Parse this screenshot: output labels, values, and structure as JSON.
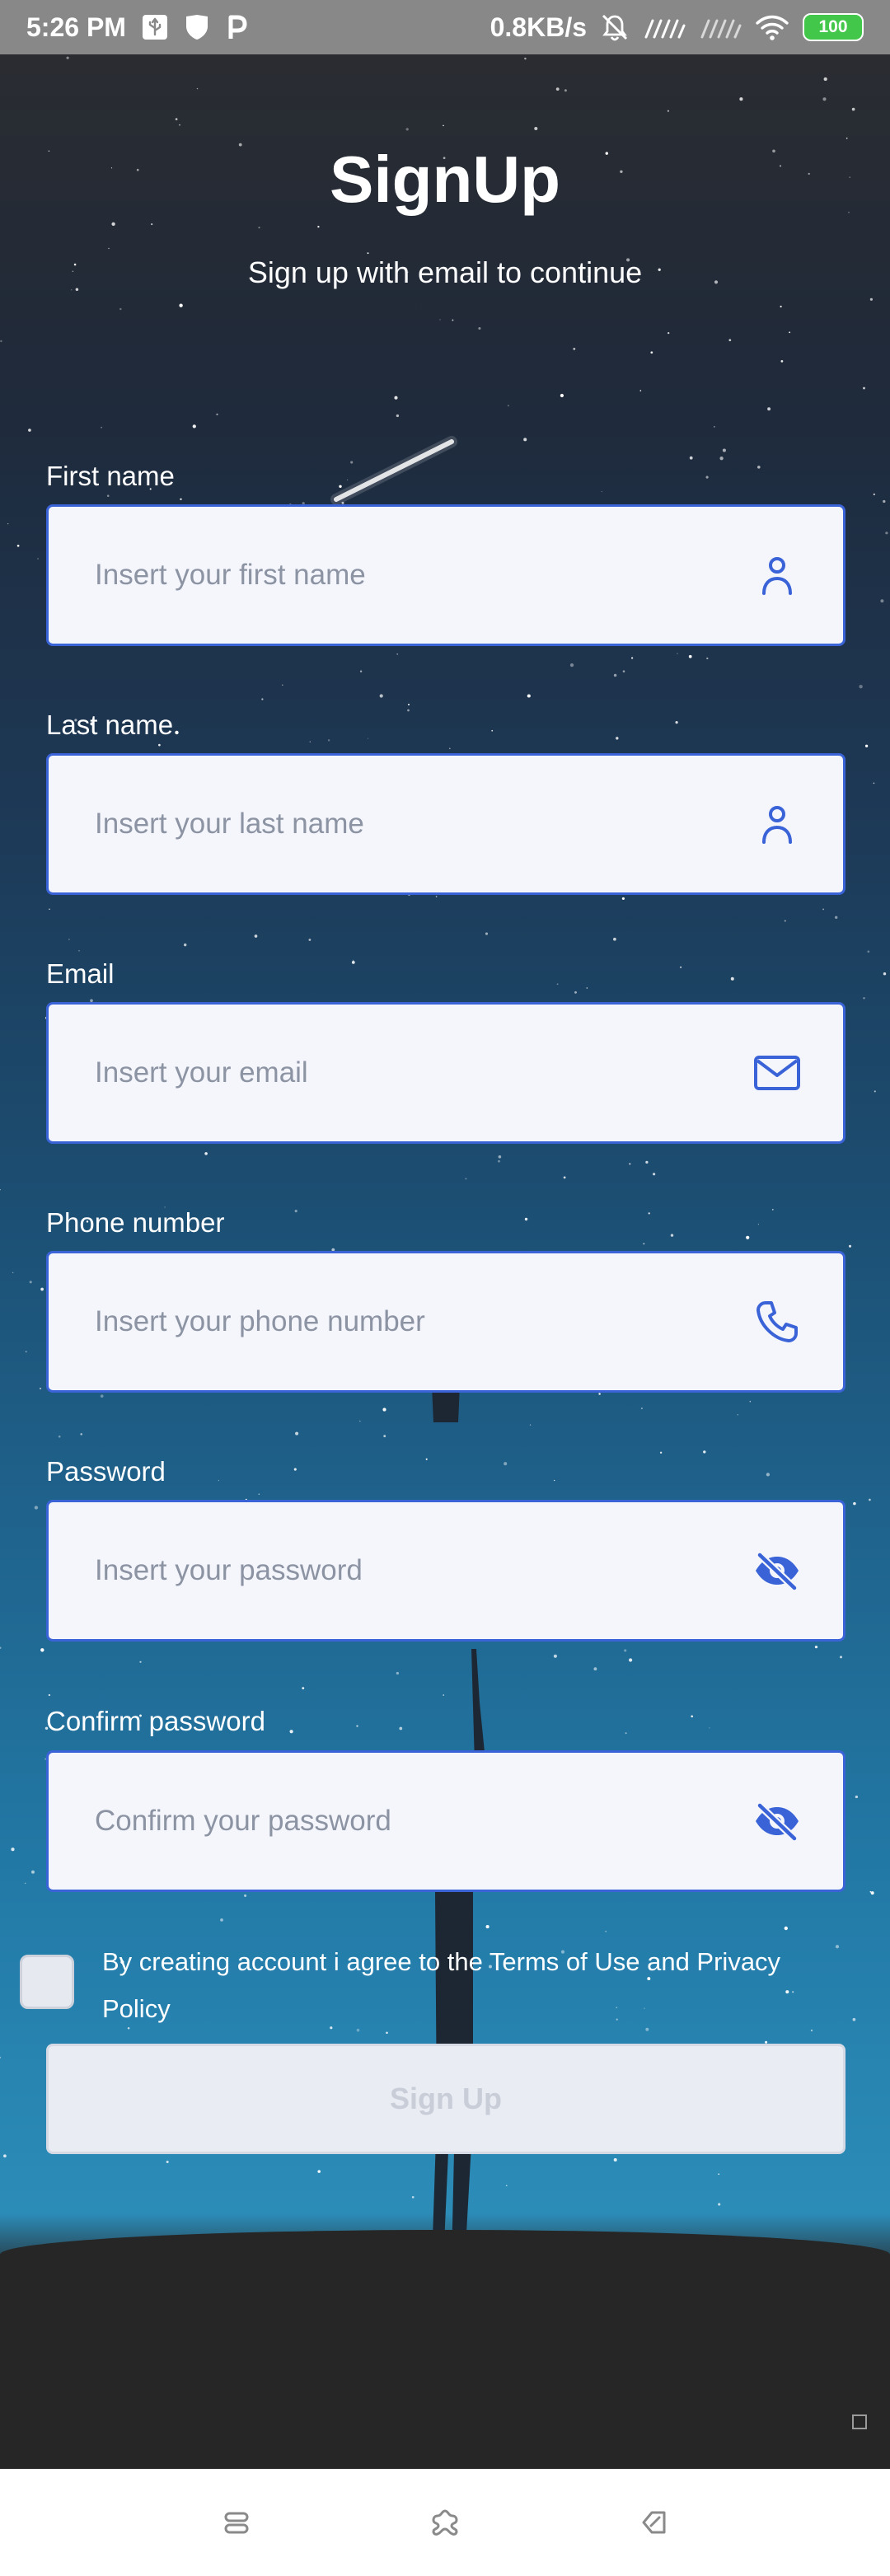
{
  "status_bar": {
    "time": "5:26 PM",
    "net_speed": "0.8KB/s",
    "battery": "100",
    "left_icons": [
      "usb-icon",
      "shield-icon",
      "p-icon"
    ],
    "right_icons": [
      "mute-icon",
      "signal-icon",
      "signal-icon",
      "wifi-icon",
      "battery-icon"
    ]
  },
  "header": {
    "title": "SignUp",
    "subtitle": "Sign up with email to continue"
  },
  "fields": {
    "first_name": {
      "label": "First name",
      "placeholder": "Insert your first name",
      "value": "",
      "icon": "user-icon"
    },
    "last_name": {
      "label": "Last name",
      "placeholder": "Insert your last name",
      "value": "",
      "icon": "user-icon"
    },
    "email": {
      "label": "Email",
      "placeholder": "Insert your email",
      "value": "",
      "icon": "mail-icon"
    },
    "phone": {
      "label": "Phone number",
      "placeholder": "Insert your phone number",
      "value": "",
      "icon": "phone-icon"
    },
    "password": {
      "label": "Password",
      "placeholder": "Insert your password",
      "value": "",
      "icon": "eye-off-icon"
    },
    "confirm_password": {
      "label": "Confirm password",
      "placeholder": "Confirm your password",
      "value": "",
      "icon": "eye-off-icon"
    }
  },
  "terms": {
    "checked": false,
    "text": "By creating account i agree to the Terms of Use and Privacy Policy"
  },
  "submit": {
    "label": "Sign Up",
    "enabled": false
  },
  "nav_bar": {
    "buttons": [
      "menu-icon",
      "home-icon",
      "back-icon"
    ]
  },
  "colors": {
    "accent": "#3a63d8",
    "field_bg": "#f4f6fc",
    "placeholder": "#8c93a3",
    "button_disabled_bg": "#e9ecf3",
    "button_disabled_text": "#c8cdd8",
    "battery": "#43c74a"
  }
}
